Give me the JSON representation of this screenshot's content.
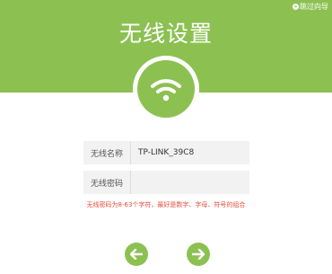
{
  "header": {
    "title": "无线设置",
    "skip_label": "跳过向导",
    "bg_color": "#8cc152"
  },
  "wifi_badge": {
    "icon": "wifi-icon"
  },
  "form": {
    "ssid": {
      "label": "无线名称",
      "value": "TP-LINK_39C8"
    },
    "password": {
      "label": "无线密码",
      "value": ""
    },
    "hint": "无线密码为8-63个字符，最好是数字、字母、符号的组合",
    "hint_color": "#e74c3c"
  },
  "nav": {
    "back_icon": "arrow-left-icon",
    "next_icon": "arrow-right-icon"
  }
}
